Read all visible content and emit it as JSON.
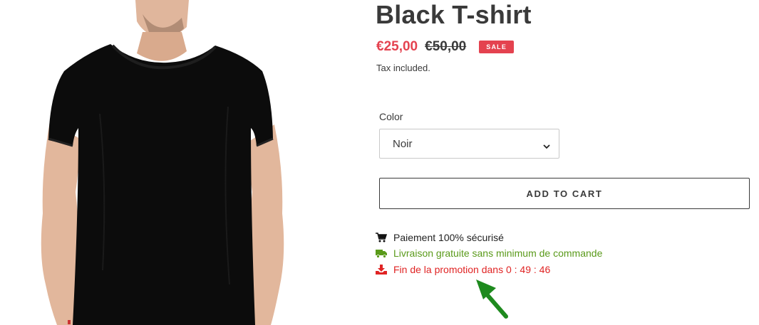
{
  "product": {
    "title": "Black T-shirt",
    "sale_price": "€25,00",
    "regular_price": "€50,00",
    "sale_badge": "SALE",
    "tax_note": "Tax included."
  },
  "color_option": {
    "label": "Color",
    "selected": "Noir"
  },
  "add_to_cart_label": "ADD TO CART",
  "features": [
    {
      "icon": "cart-icon",
      "text": "Paiement 100% sécurisé",
      "color": "#222222"
    },
    {
      "icon": "truck-icon",
      "text": "Livraison gratuite sans minimum de commande",
      "color": "#5a9a1a"
    },
    {
      "icon": "download-tray-icon",
      "text": "Fin de la promotion dans 0 : 49 : 46",
      "color": "#e02424"
    }
  ],
  "colors": {
    "sale": "#e4424f",
    "annotation_arrow": "#1e8a1e"
  }
}
